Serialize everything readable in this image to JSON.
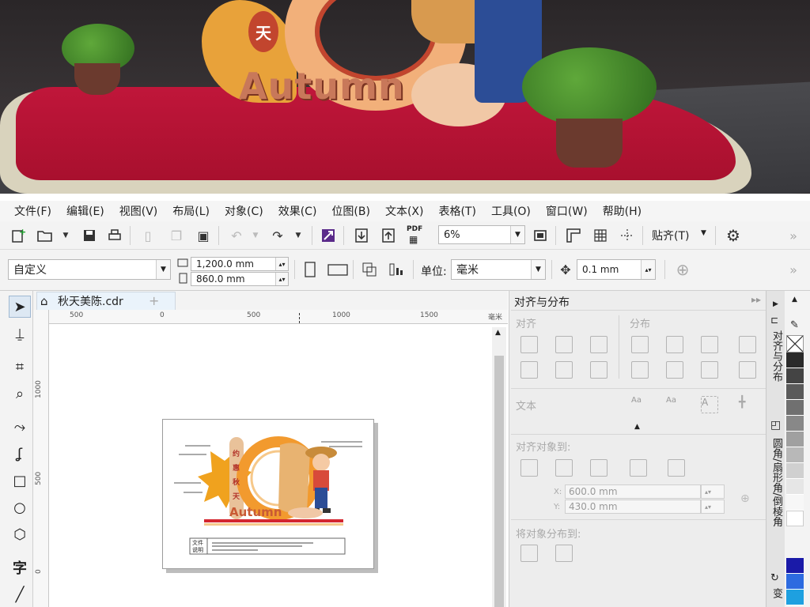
{
  "menu": [
    "文件(F)",
    "编辑(E)",
    "视图(V)",
    "布局(L)",
    "对象(C)",
    "效果(C)",
    "位图(B)",
    "文本(X)",
    "表格(T)",
    "工具(O)",
    "窗口(W)",
    "帮助(H)"
  ],
  "toolbar": {
    "zoom_value": "6%",
    "snap_label": "贴齐(T)",
    "pdf_label": "PDF"
  },
  "property_bar": {
    "page_size": "自定义",
    "width": "1,200.0 mm",
    "height": "860.0 mm",
    "units_label": "单位:",
    "units_value": "毫米",
    "nudge": "0.1 mm"
  },
  "document": {
    "tab_title": "秋天美陈.cdr",
    "h_ruler_labels": [
      "500",
      "0",
      "500",
      "1000",
      "1500",
      "毫米"
    ],
    "v_ruler_labels": [
      "1000",
      "500",
      "0"
    ]
  },
  "artwork": {
    "vertical_text": [
      "约",
      "惠",
      "秋",
      "天"
    ],
    "title": "Autumn",
    "box_label_1": "文件",
    "box_label_2": "说明"
  },
  "banner": {
    "sign_char": "天",
    "title": "Autumn"
  },
  "docker": {
    "title": "对齐与分布",
    "align_label": "对齐",
    "distribute_label": "分布",
    "text_label": "文本",
    "align_to_label": "对齐对象到:",
    "x_label": "X:",
    "x_value": "600.0 mm",
    "y_label": "Y:",
    "y_value": "430.0 mm",
    "distribute_to_label": "将对象分布到:"
  },
  "side_tabs": [
    "对齐与分布",
    "圆角/扇形角/倒棱角",
    "变"
  ],
  "palette_colors": [
    "#ffffff",
    "#2a2a2a",
    "#444444",
    "#5a5a5a",
    "#707070",
    "#888888",
    "#a0a0a0",
    "#b8b8b8",
    "#d0d0d0",
    "#e6e6e6",
    "#f7f7f7",
    "#1a1aa8",
    "#2d6be0",
    "#1ea0e0"
  ]
}
